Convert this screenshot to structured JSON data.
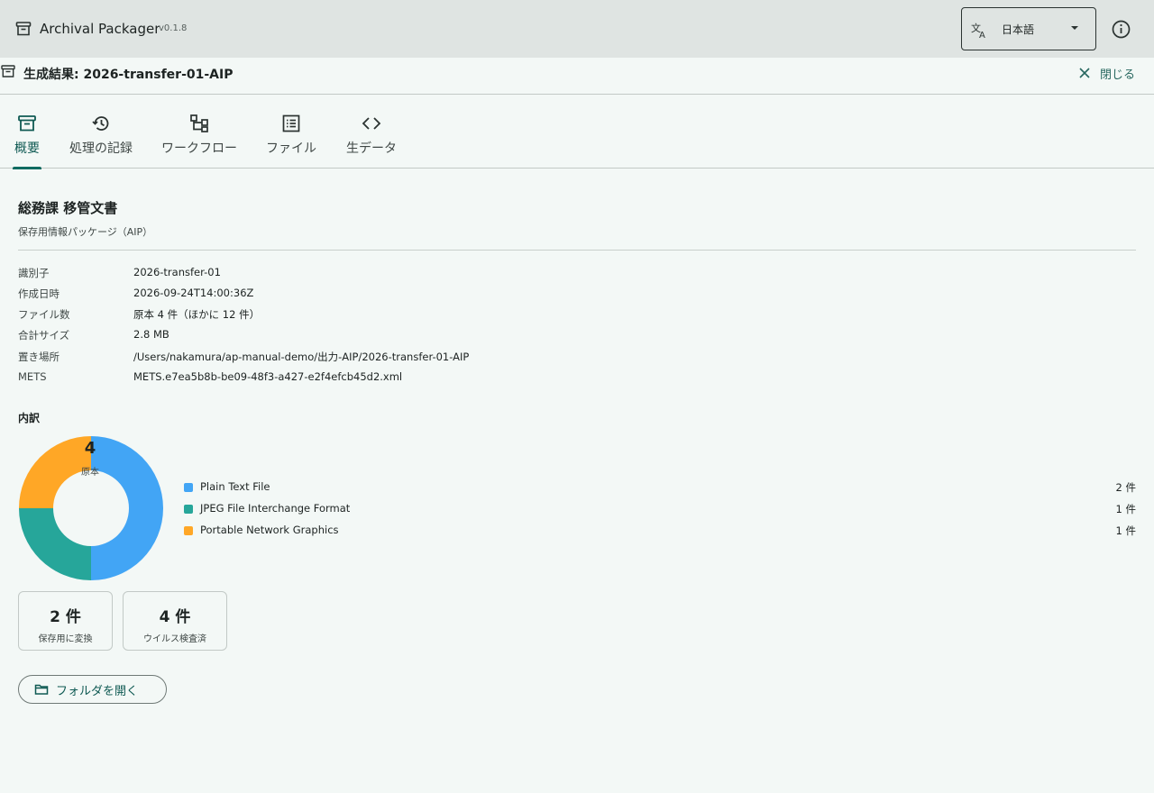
{
  "app": {
    "title": "Archival Packager",
    "version": "v0.1.8",
    "icon": "archive-box-icon"
  },
  "language": {
    "selected": "日本語",
    "icon": "translate-icon"
  },
  "result": {
    "title": "生成結果: 2026-transfer-01-AIP",
    "close_label": "閉じる"
  },
  "tabs": [
    {
      "label": "概要",
      "icon": "archive-box-icon",
      "active": true
    },
    {
      "label": "処理の記録",
      "icon": "history-icon",
      "active": false
    },
    {
      "label": "ワークフロー",
      "icon": "workflow-icon",
      "active": false
    },
    {
      "label": "ファイル",
      "icon": "file-list-icon",
      "active": false
    },
    {
      "label": "生データ",
      "icon": "code-icon",
      "active": false
    }
  ],
  "package": {
    "title": "総務課 移管文書",
    "subtitle": "保存用情報パッケージ（AIP）",
    "metadata": [
      {
        "key": "識別子",
        "value": "2026-transfer-01"
      },
      {
        "key": "作成日時",
        "value": "2026-09-24T14:00:36Z"
      },
      {
        "key": "ファイル数",
        "value": "原本 4 件（ほかに 12 件）"
      },
      {
        "key": "合計サイズ",
        "value": "2.8 MB"
      },
      {
        "key": "置き場所",
        "value": "/Users/nakamura/ap-manual-demo/出力-AIP/2026-transfer-01-AIP"
      },
      {
        "key": "METS",
        "value": "METS.e7ea5b8b-be09-48f3-a427-e2f4efcb45d2.xml"
      }
    ]
  },
  "breakdown": {
    "title": "内訳",
    "center_value": "4",
    "center_label": "原本",
    "legend": [
      {
        "name": "Plain Text File",
        "count_label": "2 件"
      },
      {
        "name": "JPEG File Interchange Format",
        "count_label": "1 件"
      },
      {
        "name": "Portable Network Graphics",
        "count_label": "1 件"
      }
    ]
  },
  "chart_data": {
    "type": "pie",
    "categories": [
      "Plain Text File",
      "JPEG File Interchange Format",
      "Portable Network Graphics"
    ],
    "values": [
      2,
      1,
      1
    ],
    "colors": [
      "#42a5f5",
      "#26a69a",
      "#ffa726"
    ]
  },
  "stats": [
    {
      "value": "2 件",
      "label": "保存用に変換"
    },
    {
      "value": "4 件",
      "label": "ウイルス検査済"
    }
  ],
  "actions": {
    "open_folder_label": "フォルダを開く",
    "open_folder_icon": "folder-icon"
  }
}
